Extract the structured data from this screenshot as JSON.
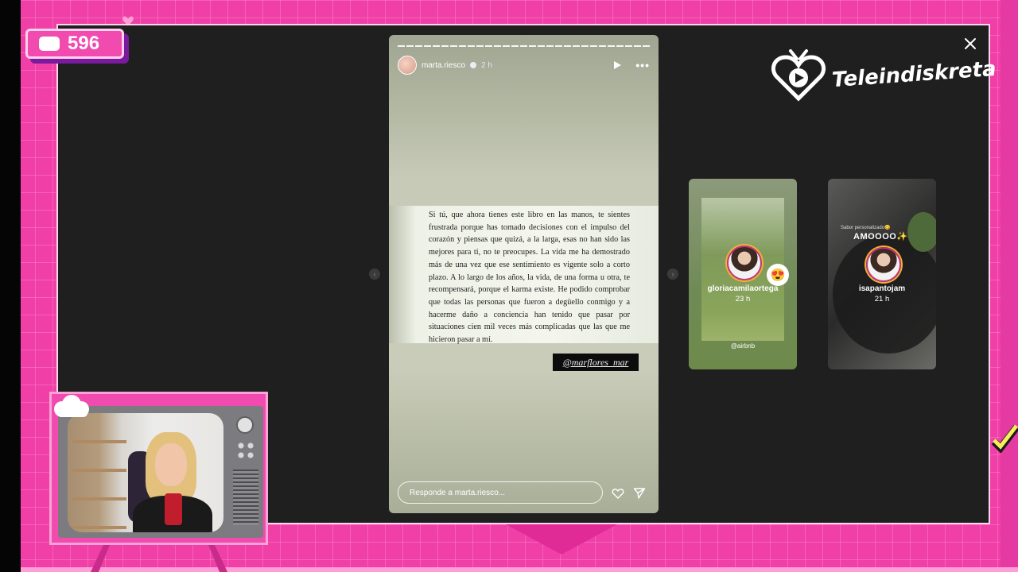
{
  "stream": {
    "viewer_count": "596",
    "brand": "Teleindiskreta"
  },
  "story": {
    "username": "marta.riesco",
    "time": "2 h",
    "book_lines": [
      "Si tú, que ahora tienes este libro en las manos, te sientes frustrada porque has tomado decisiones con el impulso del corazón y piensas que quizá, a la larga, esas no han sido las mejores para ti, no te preocupes. La vida me ha demostrado más de una vez que ese sentimiento es vigente solo a corto plazo. A lo largo de los años, la vida, de una forma u otra, te recompensará, porque el karma existe. He podido comprobar que todas las personas que fueron a degüello conmigo y a hacerme daño a conciencia han tenido que pasar por situaciones cien mil veces más complicadas que las que me hicieron pasar a mí."
    ],
    "mention": "@marflores_mar",
    "reply_placeholder": "Responde a marta.riesco..."
  },
  "previews": [
    {
      "name": "gloriacamilaortega",
      "time": "23 h",
      "tag": "@airbnb",
      "emoji": "😍"
    },
    {
      "name": "isapantojam",
      "time": "21 h",
      "overlay_title": "AMOOOO✨",
      "overlay_sub": "Sabor personalizado😋"
    }
  ],
  "icons": {
    "close": "close-icon",
    "play": "play-icon",
    "more": "more-icon",
    "heart": "heart-icon",
    "send": "send-icon"
  },
  "colors": {
    "background_pink": "#f13fa8",
    "frame_dark": "#1f1f1f",
    "shadow_purple": "#7a1a9e"
  }
}
